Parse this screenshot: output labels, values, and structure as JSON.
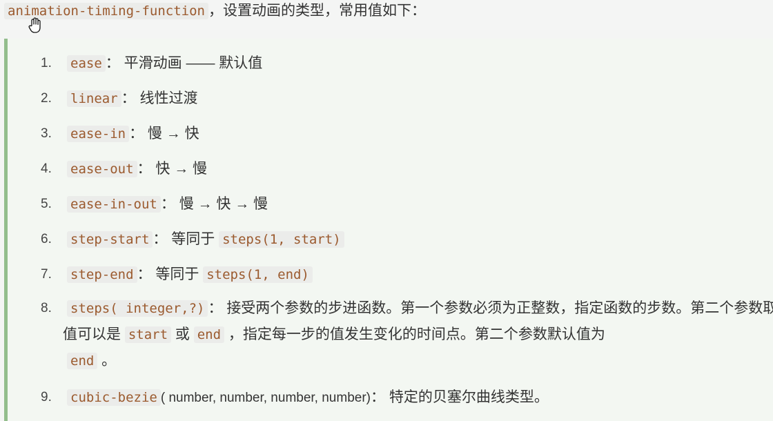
{
  "intro": {
    "code": "animation-timing-function",
    "text": "，设置动画的类型，常用值如下："
  },
  "items": [
    {
      "num": "1.",
      "code": "ease",
      "sep": "：",
      "desc": "平滑动画 —— 默认值"
    },
    {
      "num": "2.",
      "code": "linear",
      "sep": "：",
      "desc": "线性过渡"
    },
    {
      "num": "3.",
      "code": "ease-in",
      "sep": "：",
      "desc": "慢 → 快"
    },
    {
      "num": "4.",
      "code": "ease-out",
      "sep": "：",
      "desc": "快 → 慢"
    },
    {
      "num": "5.",
      "code": "ease-in-out",
      "sep": "：",
      "desc": "慢 → 快 → 慢"
    },
    {
      "num": "6.",
      "code": "step-start",
      "sep": "：",
      "desc": "等同于",
      "code2": "steps(1, start)"
    },
    {
      "num": "7.",
      "code": "step-end",
      "sep": "：",
      "desc": "等同于",
      "code2": "steps(1, end)"
    },
    {
      "num": "8.",
      "code": "steps( integer,?)",
      "sep": "：",
      "desc": "接受两个参数的步进函数。第一个参数必须为正整数，指定函数的步数。第二个参数取值可以是",
      "code_start": "start",
      "or": "或",
      "code_end": "end",
      "desc2": "，指定每一步的值发生变化的时间点。第二个参数默认值为",
      "code_end2": "end",
      "desc3": "。"
    },
    {
      "num": "9.",
      "code": "cubic-bezie",
      "args": "( number, number, number, number)",
      "sep": "：",
      "desc": "特定的贝塞尔曲线类型。"
    }
  ]
}
